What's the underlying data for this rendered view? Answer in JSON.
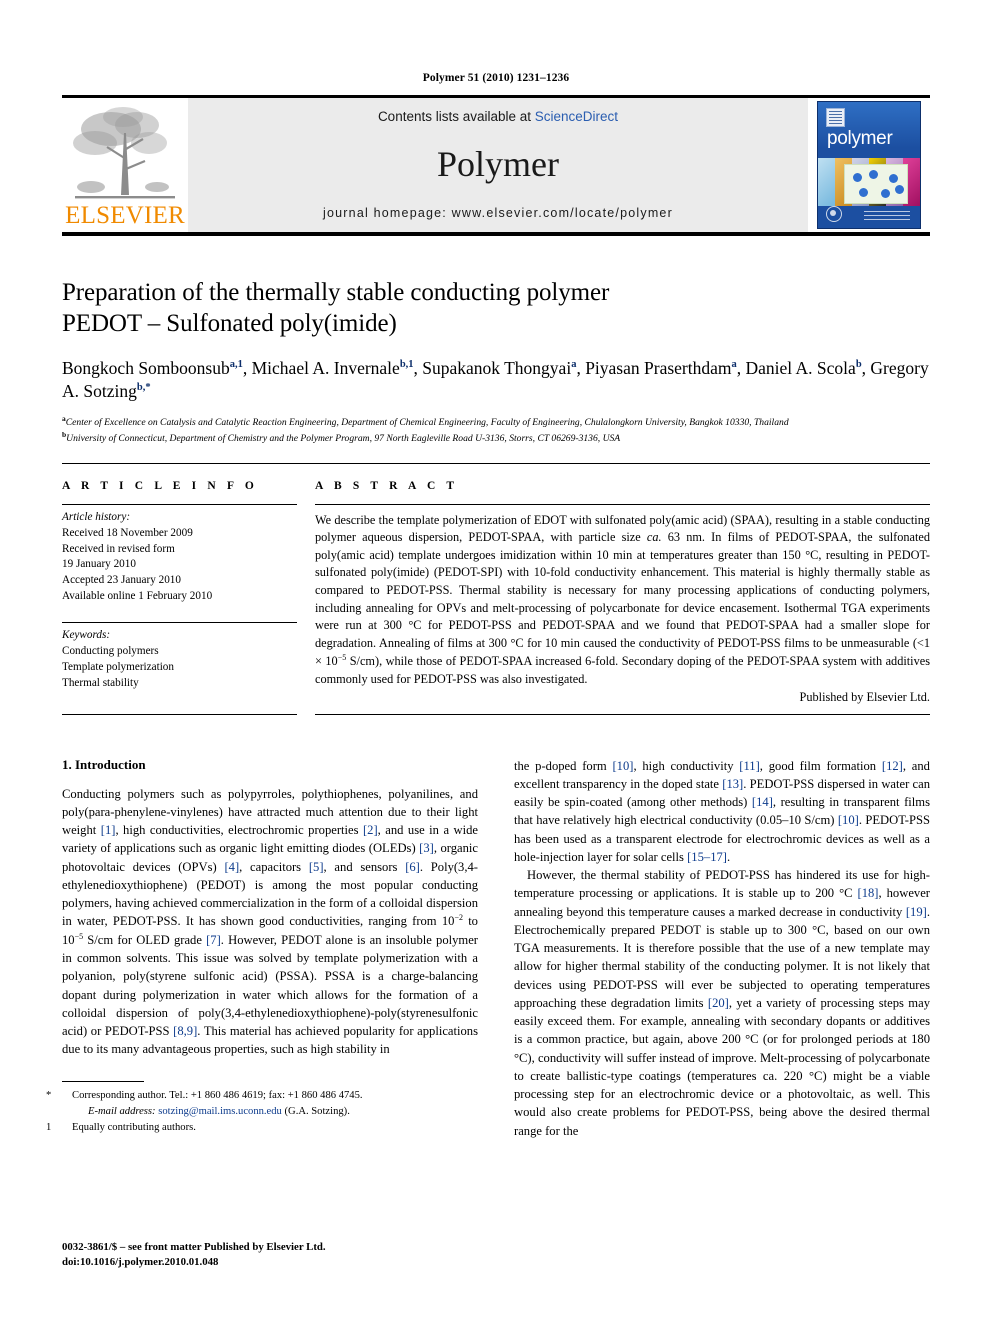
{
  "running_head": "Polymer 51 (2010) 1231–1236",
  "masthead": {
    "contents_prefix": "Contents lists available at ",
    "sciencedirect": "ScienceDirect",
    "journal_title": "Polymer",
    "homepage": "journal homepage: www.elsevier.com/locate/polymer",
    "elsevier_wordmark": "ELSEVIER",
    "cover_word": "polymer",
    "accent_orange": "#f08a00",
    "accent_blue": "#2a5db0",
    "cover_blue": "#1c4fa1",
    "masthead_bg": "#ebebeb"
  },
  "article": {
    "title_line1": "Preparation of the thermally stable conducting polymer",
    "title_line2": "PEDOT – Sulfonated poly(imide)",
    "authors": [
      {
        "name": "Bongkoch Somboonsub",
        "marks": "a,1",
        "sep": ", "
      },
      {
        "name": "Michael A. Invernale",
        "marks": "b,1",
        "sep": ", "
      },
      {
        "name": "Supakanok Thongyai",
        "marks": "a",
        "sep": ", "
      },
      {
        "name": "Piyasan Praserthdam",
        "marks": "a",
        "sep": ", "
      },
      {
        "name": "Daniel A. Scola",
        "marks": "b",
        "sep": ", "
      },
      {
        "name": "Gregory A. Sotzing",
        "marks": "b,*",
        "sep": ""
      }
    ],
    "affiliations": [
      {
        "mark": "a",
        "text": "Center of Excellence on Catalysis and Catalytic Reaction Engineering, Department of Chemical Engineering, Faculty of Engineering, Chulalongkorn University, Bangkok 10330, Thailand"
      },
      {
        "mark": "b",
        "text": "University of Connecticut, Department of Chemistry and the Polymer Program, 97 North Eagleville Road U-3136, Storrs, CT 06269-3136, USA"
      }
    ]
  },
  "article_info": {
    "heading": "A R T I C L E   I N F O",
    "history_label": "Article history:",
    "history": [
      "Received 18 November 2009",
      "Received in revised form",
      "19 January 2010",
      "Accepted 23 January 2010",
      "Available online 1 February 2010"
    ],
    "keywords_label": "Keywords:",
    "keywords": [
      "Conducting polymers",
      "Template polymerization",
      "Thermal stability"
    ]
  },
  "abstract": {
    "heading": "A B S T R A C T",
    "text_part1": "We describe the template polymerization of EDOT with sulfonated poly(amic acid) (SPAA), resulting in a stable conducting polymer aqueous dispersion, PEDOT-SPAA, with particle size ",
    "ca_italic": "ca.",
    "text_part2": " 63 nm. In films of PEDOT-SPAA, the sulfonated poly(amic acid) template undergoes imidization within 10 min at temperatures greater than 150 °C, resulting in PEDOT-sulfonated poly(imide) (PEDOT-SPI) with 10-fold conductivity enhancement. This material is highly thermally stable as compared to PEDOT-PSS. Thermal stability is necessary for many processing applications of conducting polymers, including annealing for OPVs and melt-processing of polycarbonate for device encasement. Isothermal TGA experiments were run at 300 °C for PEDOT-PSS and PEDOT-SPAA and we found that PEDOT-SPAA had a smaller slope for degradation. Annealing of films at 300 °C for 10 min caused the conductivity of PEDOT-PSS films to be unmeasurable (<1 × 10",
    "exponent": "−5",
    "text_part3": " S/cm), while those of PEDOT-SPAA increased 6-fold. Secondary doping of the PEDOT-SPAA system with additives commonly used for PEDOT-PSS was also investigated.",
    "publisher": "Published by Elsevier Ltd."
  },
  "introduction": {
    "heading": "1.  Introduction",
    "left_paragraph": "Conducting polymers such as polypyrroles, polythiophenes, polyanilines, and poly(para-phenylene-vinylenes) have attracted much attention due to their light weight [1], high conductivities, electrochromic properties [2], and use in a wide variety of applications such as organic light emitting diodes (OLEDs) [3], organic photovoltaic devices (OPVs) [4], capacitors [5], and sensors [6]. Poly(3,4-ethylenedioxythiophene) (PEDOT) is among the most popular conducting polymers, having achieved commercialization in the form of a colloidal dispersion in water, PEDOT-PSS. It has shown good conductivities, ranging from 10−2 to 10−5 S/cm for OLED grade [7]. However, PEDOT alone is an insoluble polymer in common solvents. This issue was solved by template polymerization with a polyanion, poly(styrene sulfonic acid) (PSSA). PSSA is a charge-balancing dopant during polymerization in water which allows for the formation of a colloidal dispersion of poly(3,4-ethylenedioxythiophene)-poly(styrenesulfonic acid) or PEDOT-PSS [8,9]. This material has achieved popularity for applications due to its many advantageous properties, such as high stability in",
    "right_paragraph_1": "the p-doped form [10], high conductivity [11], good film formation [12], and excellent transparency in the doped state [13]. PEDOT-PSS dispersed in water can easily be spin-coated (among other methods) [14], resulting in transparent films that have relatively high electrical conductivity (0.05–10 S/cm) [10]. PEDOT-PSS has been used as a transparent electrode for electrochromic devices as well as a hole-injection layer for solar cells [15–17].",
    "right_paragraph_2": "However, the thermal stability of PEDOT-PSS has hindered its use for high-temperature processing or applications. It is stable up to 200 °C [18], however annealing beyond this temperature causes a marked decrease in conductivity [19]. Electrochemically prepared PEDOT is stable up to 300 °C, based on our own TGA measurements. It is therefore possible that the use of a new template may allow for higher thermal stability of the conducting polymer. It is not likely that devices using PEDOT-PSS will ever be subjected to operating temperatures approaching these degradation limits [20], yet a variety of processing steps may easily exceed them. For example, annealing with secondary dopants or additives is a common practice, but again, above 200 °C (or for prolonged periods at 180 °C), conductivity will suffer instead of improve. Melt-processing of polycarbonate to create ballistic-type coatings (temperatures ca. 220 °C) might be a viable processing step for an electrochromic device or a photovoltaic, as well. This would also create problems for PEDOT-PSS, being above the desired thermal range for the"
  },
  "footnotes": {
    "corresponding": "* Corresponding author. Tel.: +1 860 486 4619; fax: +1 860 486 4745.",
    "corresponding_mark": "*",
    "corresponding_text": "Corresponding author. Tel.: +1 860 486 4619; fax: +1 860 486 4745.",
    "email_label": "E-mail address:",
    "email": "sotzing@mail.ims.uconn.edu",
    "email_owner": "(G.A. Sotzing).",
    "equal_mark": "1",
    "equal_text": "Equally contributing authors."
  },
  "imprint": {
    "line1": "0032-3861/$ – see front matter Published by Elsevier Ltd.",
    "line2": "doi:10.1016/j.polymer.2010.01.048"
  }
}
